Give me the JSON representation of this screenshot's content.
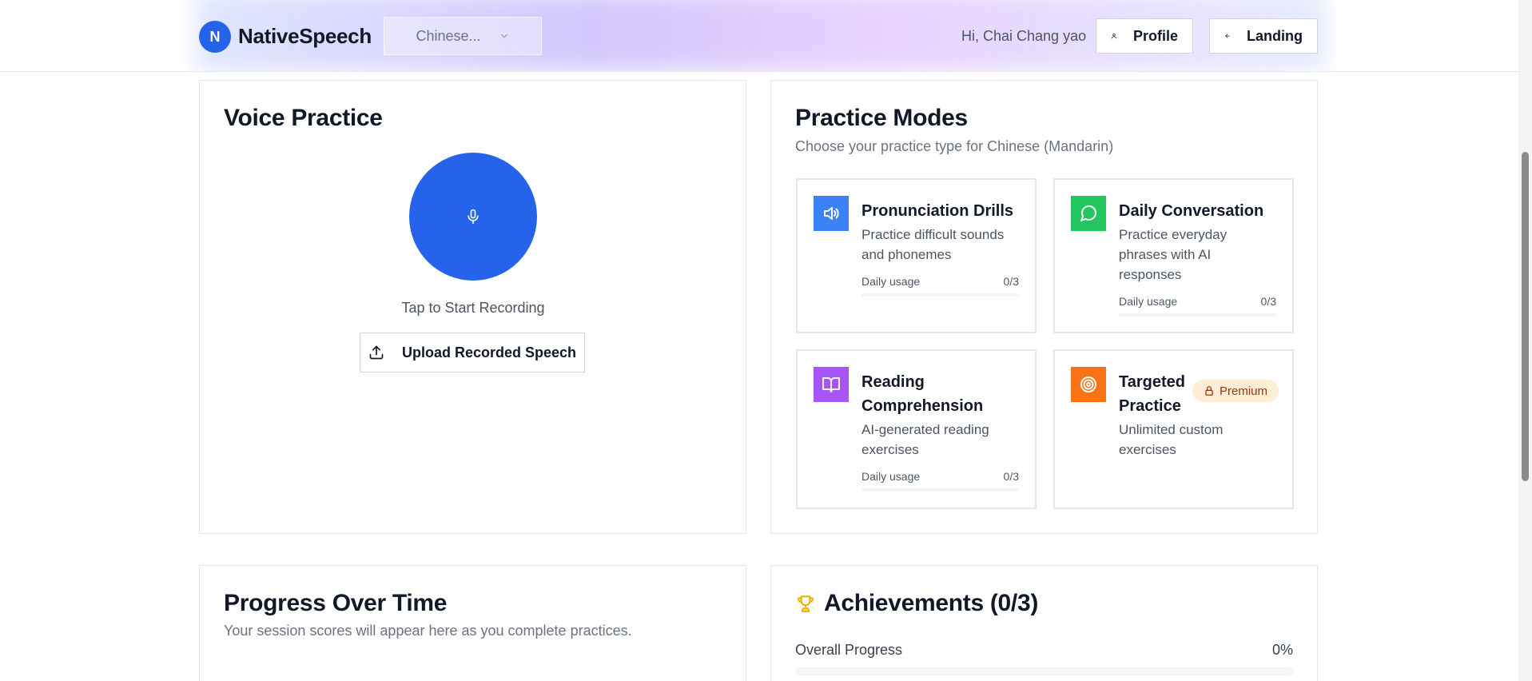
{
  "header": {
    "logo_letter": "N",
    "brand": "NativeSpeech",
    "language_select": "Chinese...",
    "greeting": "Hi, Chai Chang yao",
    "profile_label": "Profile",
    "landing_label": "Landing"
  },
  "voice_practice": {
    "title": "Voice Practice",
    "tap_label": "Tap to Start Recording",
    "upload_label": "Upload Recorded Speech"
  },
  "practice_modes": {
    "title": "Practice Modes",
    "subtitle": "Choose your practice type for Chinese (Mandarin)",
    "usage_label": "Daily usage",
    "modes": [
      {
        "title": "Pronunciation Drills",
        "desc": "Practice difficult sounds and phonemes",
        "usage": "0/3",
        "progress": 0,
        "icon": "speaker-icon",
        "color": "#3b82f6"
      },
      {
        "title": "Daily Conversation",
        "desc": "Practice everyday phrases with AI responses",
        "usage": "0/3",
        "progress": 0,
        "icon": "chat-bubble-icon",
        "color": "#22c55e"
      },
      {
        "title": "Reading Comprehension",
        "desc": "AI-generated reading exercises",
        "usage": "0/3",
        "progress": 0,
        "icon": "book-icon",
        "color": "#a855f7"
      },
      {
        "title": "Targeted Practice",
        "desc": "Unlimited custom exercises",
        "badge": "Premium",
        "icon": "target-icon",
        "color": "#f97316"
      }
    ]
  },
  "progress": {
    "title": "Progress Over Time",
    "subtitle": "Your session scores will appear here as you complete practices."
  },
  "achievements": {
    "title": "Achievements (0/3)",
    "overall_label": "Overall Progress",
    "overall_value": "0%",
    "overall_fraction": 0
  },
  "colors": {
    "accent": "#2563eb",
    "trophy": "#eab308"
  }
}
